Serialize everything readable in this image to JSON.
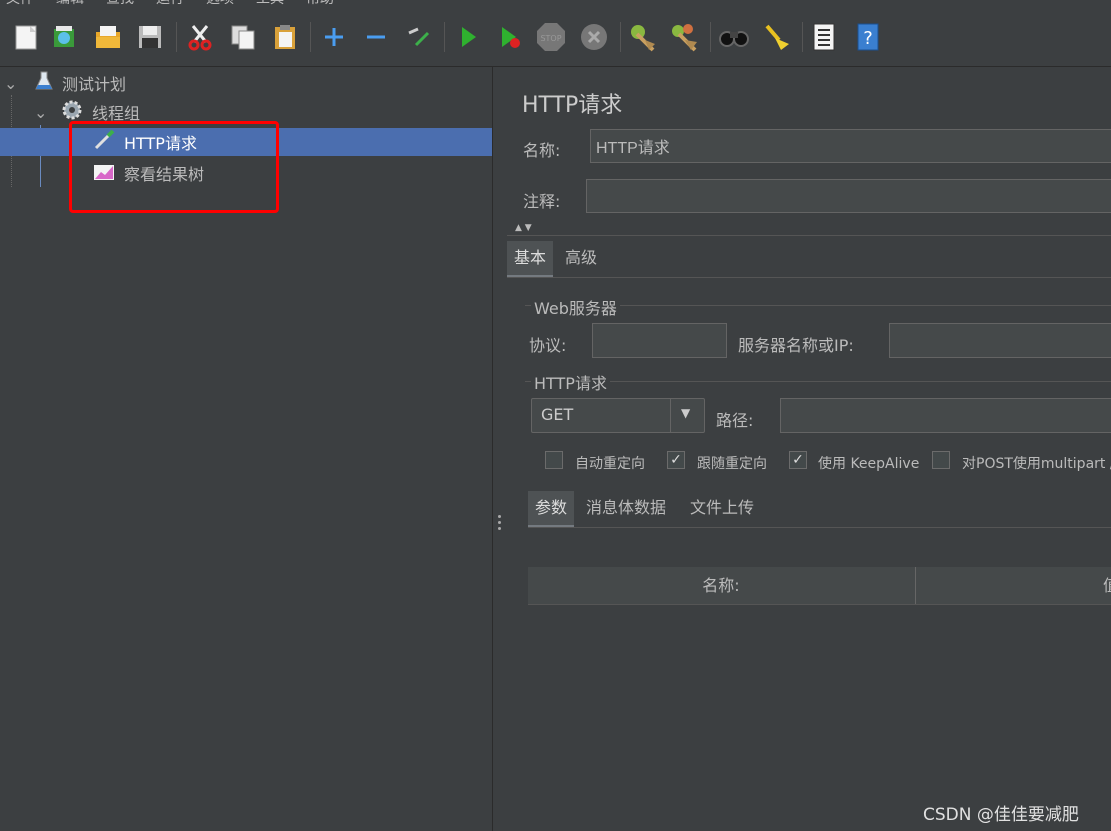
{
  "menu": [
    "文件",
    "编辑",
    "查找",
    "运行",
    "选项",
    "工具",
    "帮助"
  ],
  "toolbar": {
    "icons": [
      "new-icon",
      "templates-icon",
      "open-icon",
      "save-icon",
      "cut-icon",
      "copy-icon",
      "paste-icon",
      "add-icon",
      "remove-icon",
      "toggle-icon",
      "start-icon",
      "start-no-pause-icon",
      "stop-icon",
      "shutdown-icon",
      "clear-icon",
      "clear-all-icon",
      "search-icon",
      "reset-search-icon",
      "function-helper-icon",
      "help-icon"
    ]
  },
  "tree": {
    "test_plan": "测试计划",
    "thread_group": "线程组",
    "http_request": "HTTP请求",
    "result_tree": "察看结果树"
  },
  "panel": {
    "title": "HTTP请求",
    "name_label": "名称:",
    "name_value": "HTTP请求",
    "comment_label": "注释:",
    "tabs": {
      "basic": "基本",
      "advanced": "高级"
    },
    "web_server": {
      "legend": "Web服务器",
      "protocol_label": "协议:",
      "server_label": "服务器名称或IP:"
    },
    "http_request": {
      "legend": "HTTP请求",
      "method": "GET",
      "path_label": "路径:"
    },
    "options": [
      {
        "label": "自动重定向",
        "checked": false
      },
      {
        "label": "跟随重定向",
        "checked": true
      },
      {
        "label": "使用 KeepAlive",
        "checked": true
      },
      {
        "label": "对POST使用multipart /",
        "checked": false
      }
    ],
    "sub_tabs": {
      "params": "参数",
      "body": "消息体数据",
      "files": "文件上传"
    },
    "table": {
      "col_name": "名称:",
      "col_value": "值"
    }
  },
  "watermark": "CSDN @佳佳要减肥",
  "colors": {
    "background": "#3c3f41",
    "selection": "#4b6eaf",
    "highlight_box": "#ff0000"
  }
}
